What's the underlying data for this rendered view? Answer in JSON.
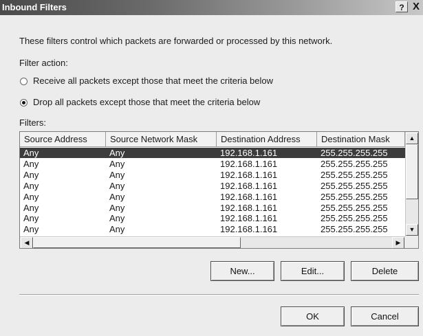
{
  "window": {
    "title": "Inbound Filters",
    "help_label": "?",
    "close_label": "X"
  },
  "description": "These filters control which packets are forwarded or processed by this network.",
  "filter_action": {
    "label": "Filter action:",
    "options": [
      {
        "label": "Receive all packets except those that meet the criteria below",
        "checked": false
      },
      {
        "label": "Drop all packets except those that meet the criteria below",
        "checked": true
      }
    ]
  },
  "filters": {
    "label": "Filters:",
    "columns": [
      "Source Address",
      "Source Network Mask",
      "Destination Address",
      "Destination Mask"
    ],
    "rows": [
      [
        "Any",
        "Any",
        "192.168.1.161",
        "255.255.255.255"
      ],
      [
        "Any",
        "Any",
        "192.168.1.161",
        "255.255.255.255"
      ],
      [
        "Any",
        "Any",
        "192.168.1.161",
        "255.255.255.255"
      ],
      [
        "Any",
        "Any",
        "192.168.1.161",
        "255.255.255.255"
      ],
      [
        "Any",
        "Any",
        "192.168.1.161",
        "255.255.255.255"
      ],
      [
        "Any",
        "Any",
        "192.168.1.161",
        "255.255.255.255"
      ],
      [
        "Any",
        "Any",
        "192.168.1.161",
        "255.255.255.255"
      ],
      [
        "Any",
        "Any",
        "192.168.1.161",
        "255.255.255.255"
      ]
    ],
    "selected_row": 0
  },
  "buttons": {
    "new": "New...",
    "edit": "Edit...",
    "delete": "Delete",
    "ok": "OK",
    "cancel": "Cancel"
  },
  "icons": {
    "scroll_up": "▲",
    "scroll_down": "▼",
    "scroll_left": "◀",
    "scroll_right": "▶"
  },
  "colors": {
    "selection": "#3c3c3c",
    "titlebar_start": "#4a4a4a",
    "titlebar_end": "#c8c8c8"
  }
}
